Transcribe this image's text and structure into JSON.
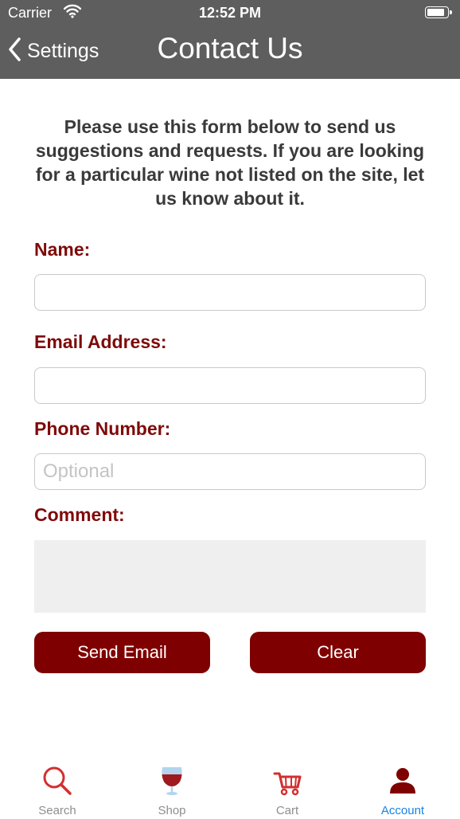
{
  "status": {
    "carrier": "Carrier",
    "time": "12:52 PM"
  },
  "nav": {
    "back_label": "Settings",
    "title": "Contact Us"
  },
  "intro": "Please use this form below to send us suggestions and requests. If you are looking for a particular wine not listed on the site, let us know about it.",
  "form": {
    "name_label": "Name:",
    "name_value": "",
    "email_label": "Email Address:",
    "email_value": "",
    "phone_label": "Phone Number:",
    "phone_placeholder": "Optional",
    "comment_label": "Comment:",
    "comment_value": ""
  },
  "buttons": {
    "send": "Send Email",
    "clear": "Clear"
  },
  "tabs": [
    {
      "label": "Search",
      "icon": "search-icon"
    },
    {
      "label": "Shop",
      "icon": "wine-glass-icon"
    },
    {
      "label": "Cart",
      "icon": "cart-icon"
    },
    {
      "label": "Account",
      "icon": "person-icon",
      "active": true
    }
  ],
  "colors": {
    "bar": "#5e5e5e",
    "accent": "#7f0000",
    "label": "#7f0a0a",
    "active_tab": "#1a82e6",
    "icon_red": "#d32f2f"
  }
}
